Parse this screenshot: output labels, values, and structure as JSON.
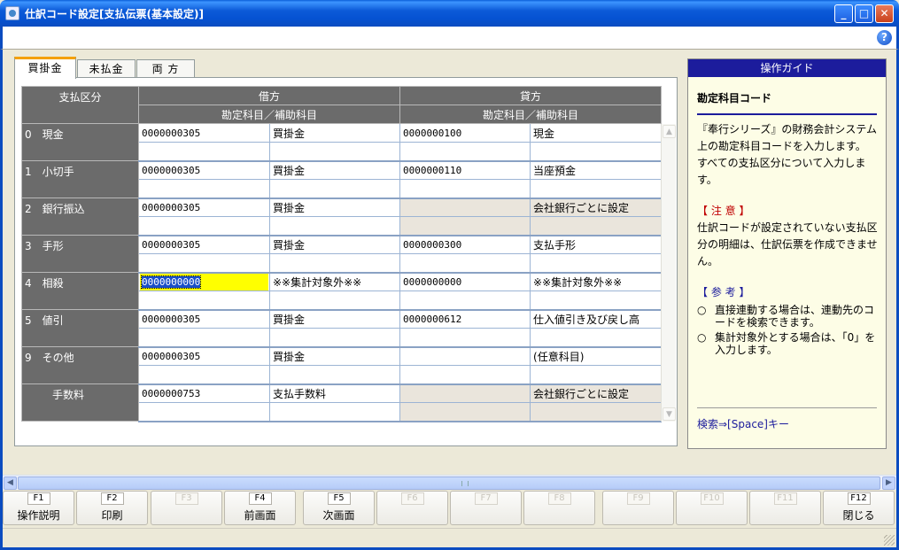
{
  "window": {
    "title": "仕訳コード設定[支払伝票(基本設定)]"
  },
  "tabs": [
    {
      "label": "買掛金",
      "active": true
    },
    {
      "label": "未払金",
      "active": false
    },
    {
      "label": "両 方",
      "active": false
    }
  ],
  "grid": {
    "header": {
      "kubun": "支払区分",
      "debit": "借方",
      "credit": "貸方",
      "debit_sub": "勘定科目／補助科目",
      "credit_sub": "勘定科目／補助科目"
    },
    "rows": [
      {
        "label": "0　現金",
        "debit_code": "0000000305",
        "debit_name": "買掛金",
        "credit_code": "0000000100",
        "credit_name": "現金"
      },
      {
        "label": "1　小切手",
        "debit_code": "0000000305",
        "debit_name": "買掛金",
        "credit_code": "0000000110",
        "credit_name": "当座預金"
      },
      {
        "label": "2　銀行振込",
        "debit_code": "0000000305",
        "debit_name": "買掛金",
        "credit_code": "",
        "credit_name": "会社銀行ごとに設定"
      },
      {
        "label": "3　手形",
        "debit_code": "0000000305",
        "debit_name": "買掛金",
        "credit_code": "0000000300",
        "credit_name": "支払手形"
      },
      {
        "label": "4　相殺",
        "debit_code": "0000000000",
        "debit_name": "※※集計対象外※※",
        "credit_code": "0000000000",
        "credit_name": "※※集計対象外※※"
      },
      {
        "label": "5　値引",
        "debit_code": "0000000305",
        "debit_name": "買掛金",
        "credit_code": "0000000612",
        "credit_name": "仕入値引き及び戻し高"
      },
      {
        "label": "9　その他",
        "debit_code": "0000000305",
        "debit_name": "買掛金",
        "credit_code": "",
        "credit_name": "(任意科目)"
      },
      {
        "label": "手数料",
        "debit_code": "0000000753",
        "debit_name": "支払手数料",
        "credit_code": "",
        "credit_name": "会社銀行ごとに設定"
      }
    ]
  },
  "guide": {
    "header": "操作ガイド",
    "title": "勘定科目コード",
    "body": "『奉行シリーズ』の財務会計システム上の勘定科目コードを入力します。\nすべての支払区分について入力します。",
    "note_head": "【 注 意 】",
    "note_body": "仕訳コードが設定されていない支払区分の明細は、仕訳伝票を作成できません。",
    "ref_head": "【 参 考 】",
    "ref_items": [
      "直接連動する場合は、連動先のコードを検索できます。",
      "集計対象外とする場合は、「0」を入力します。"
    ],
    "bullet_mark": "○",
    "footer": "検索⇒[Space]キー"
  },
  "fkeys": [
    {
      "key": "F1",
      "label": "操作説明",
      "enabled": true
    },
    {
      "key": "F2",
      "label": "印刷",
      "enabled": true
    },
    {
      "key": "F3",
      "label": "",
      "enabled": false
    },
    {
      "key": "F4",
      "label": "前画面",
      "enabled": true
    },
    {
      "key": "F5",
      "label": "次画面",
      "enabled": true
    },
    {
      "key": "F6",
      "label": "",
      "enabled": false
    },
    {
      "key": "F7",
      "label": "",
      "enabled": false
    },
    {
      "key": "F8",
      "label": "",
      "enabled": false
    },
    {
      "key": "F9",
      "label": "",
      "enabled": false
    },
    {
      "key": "F10",
      "label": "",
      "enabled": false
    },
    {
      "key": "F11",
      "label": "",
      "enabled": false
    },
    {
      "key": "F12",
      "label": "閉じる",
      "enabled": true
    }
  ],
  "colors": {
    "titlebar": "#0552d2",
    "guide_header": "#1c1c9c",
    "selected_cell": "#ffff00",
    "row_header": "#6b6b6b",
    "gray_cell": "#eae5dc"
  }
}
